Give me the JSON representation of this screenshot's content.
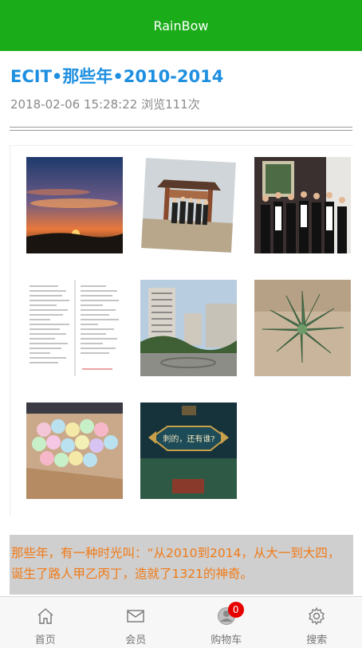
{
  "header": {
    "title": "RainBow"
  },
  "article": {
    "title": "ECIT•那些年•2010-2014",
    "meta": "2018-02-06 15:28:22 浏览111次",
    "excerpt": "那些年，有一种时光叫：“从2010到2014，从大一到大四，诞生了路人甲乙丙丁，造就了1321的神奇。"
  },
  "gallery": {
    "photos": [
      {
        "icon": "sunset-photo"
      },
      {
        "icon": "group-gate-photo"
      },
      {
        "icon": "group-indoor-photo"
      },
      {
        "icon": "document-photo"
      },
      {
        "icon": "buildings-photo"
      },
      {
        "icon": "succulent-plant-photo"
      },
      {
        "icon": "paper-flowers-photo"
      },
      {
        "icon": "game-screen-photo"
      }
    ],
    "game_caption": "刺的，还有谁?"
  },
  "tabbar": {
    "items": [
      {
        "label": "首页",
        "icon": "home-icon"
      },
      {
        "label": "会员",
        "icon": "mail-icon"
      },
      {
        "label": "购物车",
        "icon": "cart-avatar-icon",
        "badge": "0"
      },
      {
        "label": "搜索",
        "icon": "gear-icon"
      }
    ]
  },
  "colors": {
    "header_bg": "#1aad19",
    "title": "#1e8fe0",
    "excerpt_text": "#f07a17",
    "badge": "#e60000"
  }
}
